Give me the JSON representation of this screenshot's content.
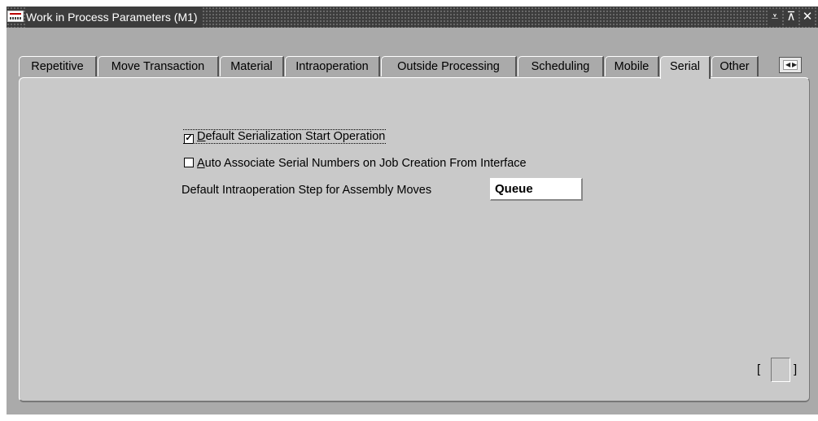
{
  "window": {
    "title": "Work in Process Parameters (M1)",
    "controls": {
      "minimize": "⩡",
      "maximize": "⊼",
      "close": "✕"
    }
  },
  "tabs": [
    {
      "label": "Repetitive",
      "active": false
    },
    {
      "label": "Move Transaction",
      "active": false
    },
    {
      "label": "Material",
      "active": false
    },
    {
      "label": "Intraoperation",
      "active": false
    },
    {
      "label": "Outside Processing",
      "active": false
    },
    {
      "label": "Scheduling",
      "active": false
    },
    {
      "label": "Mobile",
      "active": false
    },
    {
      "label": "Serial",
      "active": true
    },
    {
      "label": "Other",
      "active": false
    }
  ],
  "serial": {
    "default_serialization_start_operation": {
      "label": "Default Serialization Start Operation",
      "mnemonic": "D",
      "checked": true
    },
    "auto_associate_serial_numbers": {
      "label": "Auto Associate Serial Numbers on Job Creation From Interface",
      "mnemonic": "A",
      "checked": false
    },
    "default_intraoperation_step": {
      "label": "Default Intraoperation Step for Assembly Moves",
      "value": "Queue"
    }
  },
  "icons": {
    "tab_scroll": "tab-scroll-icon",
    "app": "oracle-app-icon"
  },
  "colors": {
    "titlebar": "#3c3c3c",
    "window_bg": "#aaaaaa",
    "panel_bg": "#c9c9c9"
  }
}
